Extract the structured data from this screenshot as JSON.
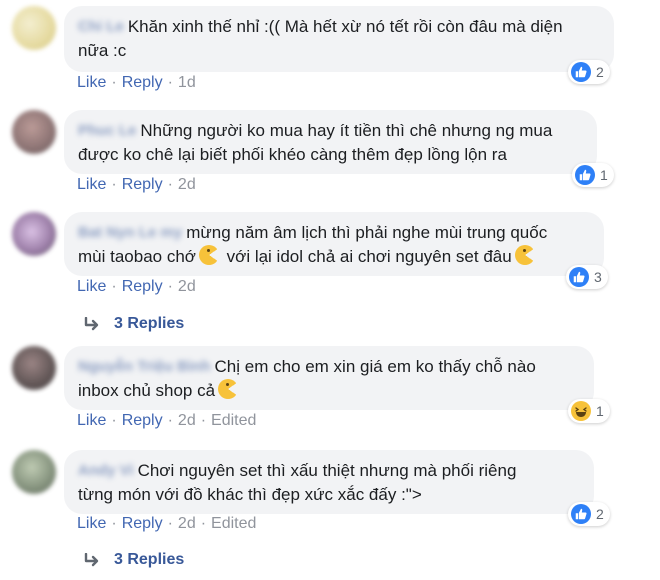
{
  "colors": {
    "link": "#4267b2",
    "meta": "#90949c",
    "bubble": "#f2f3f5",
    "like": "#2e80f7",
    "haha": "#f7c23a"
  },
  "labels": {
    "like": "Like",
    "reply": "Reply",
    "edited": "Edited"
  },
  "comments": [
    {
      "author": "Chi Le",
      "text_1": "Khăn xinh thế nhỉ :(( Mà hết xừ nó tết rồi còn đâu mà diện",
      "text_2": "nữa :c",
      "time": "1d",
      "reaction_type": "like-icon",
      "reaction_count": "2"
    },
    {
      "author": "Phuc Le",
      "text_1": "Những người ko mua hay ít tiền thì chê nhưng ng mua",
      "text_2": "được ko chê lại biết phối khéo càng thêm đẹp lồng lộn ra",
      "time": "2d",
      "reaction_type": "like-icon",
      "reaction_count": "1"
    },
    {
      "author": "Bat Nyn Le my",
      "text_1": "mừng năm âm lịch thì phải nghe mùi trung quốc",
      "text_2a": "mùi taobao chớ",
      "text_2b": "với lại idol chả ai chơi nguyên set đâu",
      "time": "2d",
      "reaction_type": "like-icon",
      "reaction_count": "3"
    },
    {
      "author": "Nguyễn Triệu Bình",
      "text_1": "Chị em cho em xin giá em ko thấy chỗ nào",
      "text_2": "inbox chủ shop cả",
      "time": "2d",
      "edited": true,
      "reaction_type": "haha-icon",
      "reaction_count": "1"
    },
    {
      "author": "Andy Vi",
      "text_1": "Chơi nguyên set thì xấu thiệt nhưng mà phối riêng",
      "text_2": "từng món với đồ khác thì đẹp xức xắc đấy :\">",
      "time": "2d",
      "edited": true,
      "reaction_type": "like-icon",
      "reaction_count": "2"
    }
  ],
  "reply_threads": [
    {
      "label": "3 Replies"
    },
    {
      "label": "3 Replies"
    }
  ]
}
